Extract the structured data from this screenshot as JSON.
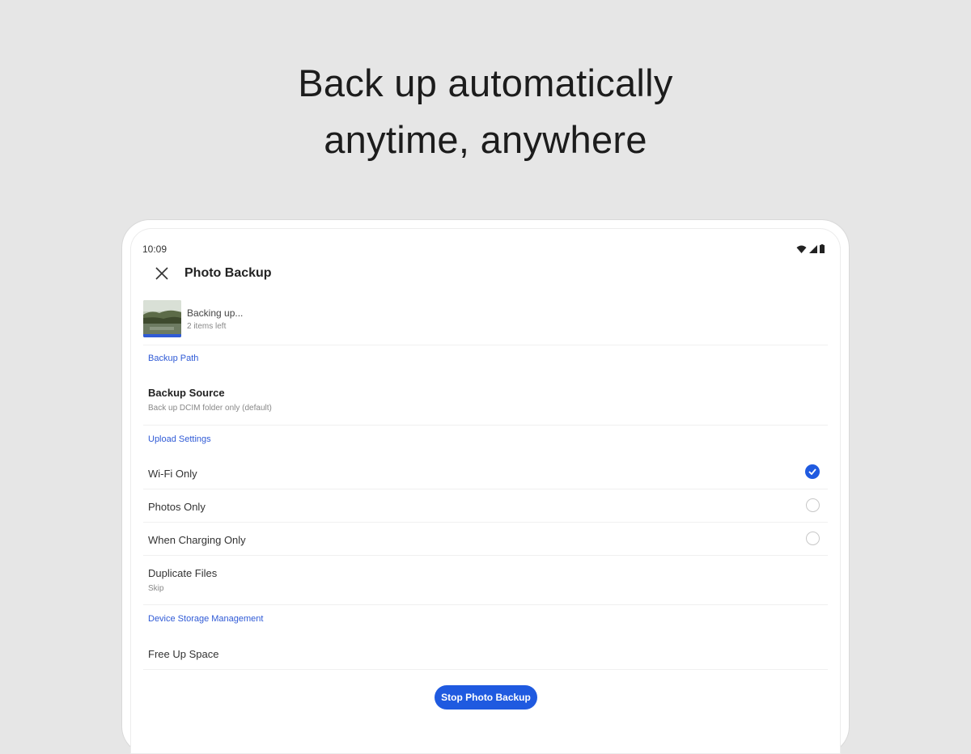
{
  "headline": {
    "line1": "Back up automatically",
    "line2": "anytime, anywhere"
  },
  "status_bar": {
    "time": "10:09",
    "icons": [
      "wifi-icon",
      "cell-signal-icon",
      "battery-icon"
    ]
  },
  "app_bar": {
    "close_icon": "close-icon",
    "title": "Photo Backup"
  },
  "progress": {
    "title": "Backing up...",
    "subtitle": "2 items left"
  },
  "sections": {
    "backup_path": "Backup Path",
    "upload_settings": "Upload Settings",
    "device_storage": "Device Storage Management"
  },
  "backup_source": {
    "title": "Backup Source",
    "subtitle": "Back up DCIM folder only (default)"
  },
  "upload_options": [
    {
      "label": "Wi-Fi Only",
      "checked": true
    },
    {
      "label": "Photos Only",
      "checked": false
    },
    {
      "label": "When Charging Only",
      "checked": false
    }
  ],
  "duplicate_files": {
    "title": "Duplicate Files",
    "value": "Skip"
  },
  "free_up_space": {
    "label": "Free Up Space"
  },
  "stop_button": {
    "label": "Stop Photo Backup"
  },
  "colors": {
    "accent": "#1f5ae0",
    "section_text": "#2f5ad6",
    "background": "#e6e6e6"
  }
}
